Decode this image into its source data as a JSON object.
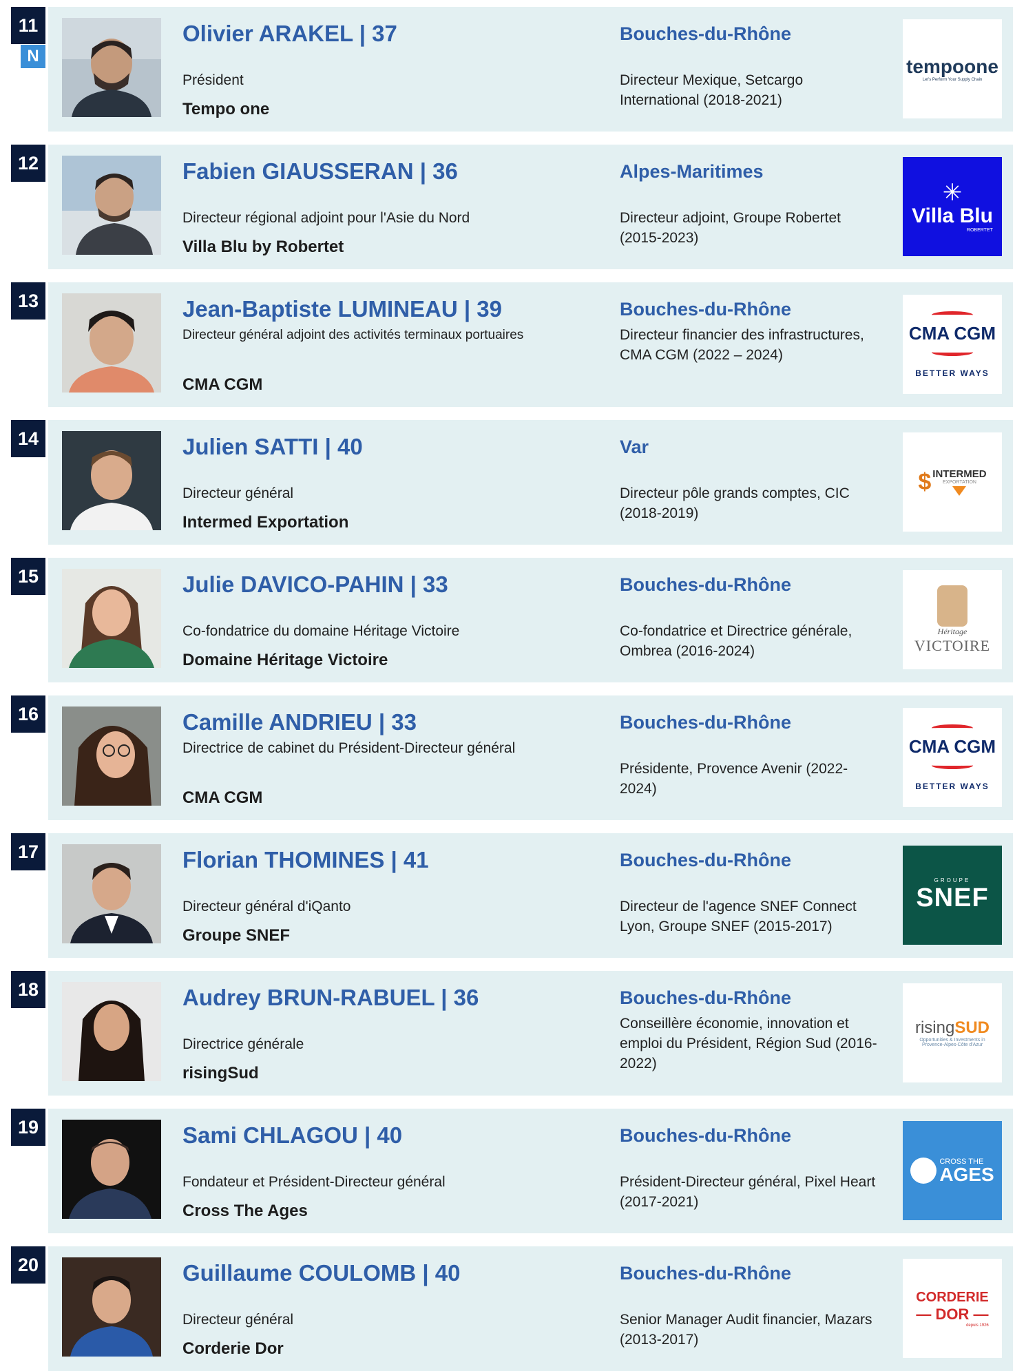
{
  "entries": [
    {
      "rank": "11",
      "badge": "N",
      "name": "Olivier ARAKEL | 37",
      "role": "Président",
      "org": "Tempo one",
      "region": "Bouches-du-Rhône",
      "previous": "Directeur Mexique, Setcargo International (2018-2021)",
      "logo": {
        "text": "tempo",
        "text2": "one",
        "tagline": "Let's Perform Your Supply Chain"
      }
    },
    {
      "rank": "12",
      "name": "Fabien GIAUSSERAN | 36",
      "role": "Directeur régional adjoint pour l'Asie du Nord",
      "org": "Villa Blu by Robertet",
      "region": "Alpes-Maritimes",
      "previous": "Directeur adjoint, Groupe Robertet (2015-2023)",
      "logo": {
        "text": "Villa Blu",
        "sub": "ROBERTET"
      }
    },
    {
      "rank": "13",
      "name": "Jean-Baptiste LUMINEAU | 39",
      "role": "Directeur général adjoint des activités terminaux portuaires",
      "org": "CMA CGM",
      "region": "Bouches-du-Rhône",
      "previous": "Directeur financier des infrastructures, CMA CGM (2022 – 2024)",
      "logo": {
        "text": "CMA CGM",
        "sub": "BETTER WAYS"
      }
    },
    {
      "rank": "14",
      "name": "Julien SATTI | 40",
      "role": "Directeur général",
      "org": "Intermed Exportation",
      "region": "Var",
      "previous": "Directeur pôle grands comptes, CIC (2018-2019)",
      "logo": {
        "text": "INTERMED",
        "sub": "EXPORTATION"
      }
    },
    {
      "rank": "15",
      "name": "Julie DAVICO-PAHIN | 33",
      "role": "Co-fondatrice du domaine Héritage Victoire",
      "org": "Domaine Héritage Victoire",
      "region": "Bouches-du-Rhône",
      "previous": "Co-fondatrice et Directrice générale, Ombrea (2016-2024)",
      "logo": {
        "text": "VICTOIRE",
        "sub": "Héritage"
      }
    },
    {
      "rank": "16",
      "name": "Camille ANDRIEU | 33",
      "role": "Directrice de cabinet du Président-Directeur général",
      "org": "CMA CGM",
      "region": "Bouches-du-Rhône",
      "previous": "Présidente, Provence Avenir (2022-2024)",
      "logo": {
        "text": "CMA CGM",
        "sub": "BETTER WAYS"
      }
    },
    {
      "rank": "17",
      "name": "Florian THOMINES | 41",
      "role": "Directeur général d'iQanto",
      "org": "Groupe SNEF",
      "region": "Bouches-du-Rhône",
      "previous": "Directeur de l'agence SNEF Connect Lyon, Groupe SNEF (2015-2017)",
      "logo": {
        "text": "SNEF",
        "sub": "GROUPE"
      }
    },
    {
      "rank": "18",
      "name": "Audrey BRUN-RABUEL | 36",
      "role": "Directrice générale",
      "org": "risingSud",
      "region": "Bouches-du-Rhône",
      "previous": "Conseillère économie, innovation et emploi du Président, Région Sud (2016-2022)",
      "logo": {
        "text": "rising",
        "text2": "SUD",
        "tagline": "Opportunities & Investments in Provence-Alpes-Côte d'Azur"
      }
    },
    {
      "rank": "19",
      "name": "Sami CHLAGOU | 40",
      "role": "Fondateur et Président-Directeur général",
      "org": "Cross The Ages",
      "region": "Bouches-du-Rhône",
      "previous": "Président-Directeur général, Pixel Heart (2017-2021)",
      "logo": {
        "text": "AGES",
        "sub": "CROSS THE"
      }
    },
    {
      "rank": "20",
      "name": "Guillaume COULOMB | 40",
      "role": "Directeur général",
      "org": "Corderie Dor",
      "region": "Bouches-du-Rhône",
      "previous": "Senior Manager Audit financier, Mazars (2013-2017)",
      "logo": {
        "text": "CORDERIE",
        "text2": "DOR",
        "tagline": "depuis 1926"
      }
    }
  ]
}
